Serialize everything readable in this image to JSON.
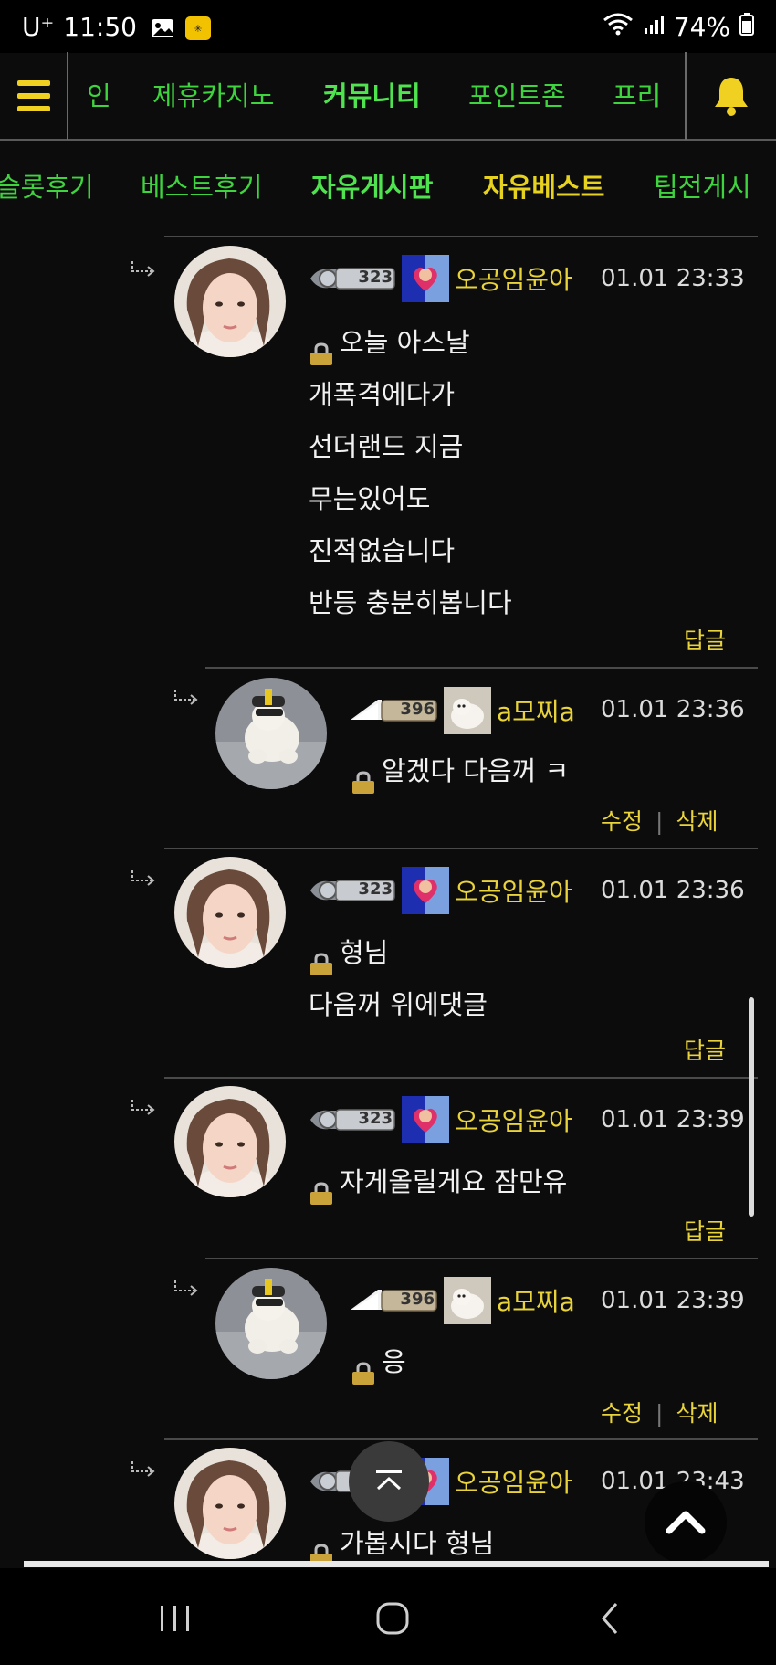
{
  "status_bar": {
    "carrier": "U⁺",
    "time": "11:50",
    "battery": "74%"
  },
  "top_nav": {
    "items": [
      {
        "label": "인",
        "active": false
      },
      {
        "label": "제휴카지노",
        "active": false
      },
      {
        "label": "커뮤니티",
        "active": true
      },
      {
        "label": "포인트존",
        "active": false
      },
      {
        "label": "프리",
        "active": false
      }
    ]
  },
  "sub_nav": {
    "items": [
      {
        "label": "슬롯후기"
      },
      {
        "label": "베스트후기"
      },
      {
        "label": "자유게시판"
      },
      {
        "label": "자유베스트"
      },
      {
        "label": "팁전게시"
      }
    ]
  },
  "comments": [
    {
      "level": "323",
      "nick": "오공임윤아",
      "time": "01.01 23:33",
      "lines": [
        "오늘 아스날",
        "개폭격에다가",
        "선더랜드 지금",
        "무는있어도",
        "진적없습니다",
        "반등 충분히봅니다"
      ],
      "actions": [
        "답글"
      ]
    },
    {
      "level": "396",
      "nick": "a모찌a",
      "time": "01.01 23:36",
      "lines": [
        "알겠다 다음꺼 ㅋ"
      ],
      "actions": [
        "수정",
        "삭제"
      ]
    },
    {
      "level": "323",
      "nick": "오공임윤아",
      "time": "01.01 23:36",
      "lines": [
        "형님",
        "다음꺼 위에댓글"
      ],
      "actions": [
        "답글"
      ]
    },
    {
      "level": "323",
      "nick": "오공임윤아",
      "time": "01.01 23:39",
      "lines": [
        "자게올릴게요 잠만유"
      ],
      "actions": [
        "답글"
      ]
    },
    {
      "level": "396",
      "nick": "a모찌a",
      "time": "01.01 23:39",
      "lines": [
        "응"
      ],
      "actions": [
        "수정",
        "삭제"
      ]
    },
    {
      "level": "323",
      "nick": "오공임윤아",
      "time": "01.01 23:43",
      "lines": [
        "가봅시다 형님"
      ],
      "actions": []
    }
  ],
  "colors": {
    "accent_green": "#3ed43e",
    "accent_yellow": "#e9d33a",
    "background": "#0c0c0c"
  },
  "icons": {
    "menu": "hamburger-icon",
    "bell": "bell-icon",
    "lock": "lock-icon",
    "reply_arrow": "reply-arrow-icon",
    "scroll_up": "chevron-up-icon",
    "to_top": "chevron-up-icon"
  }
}
